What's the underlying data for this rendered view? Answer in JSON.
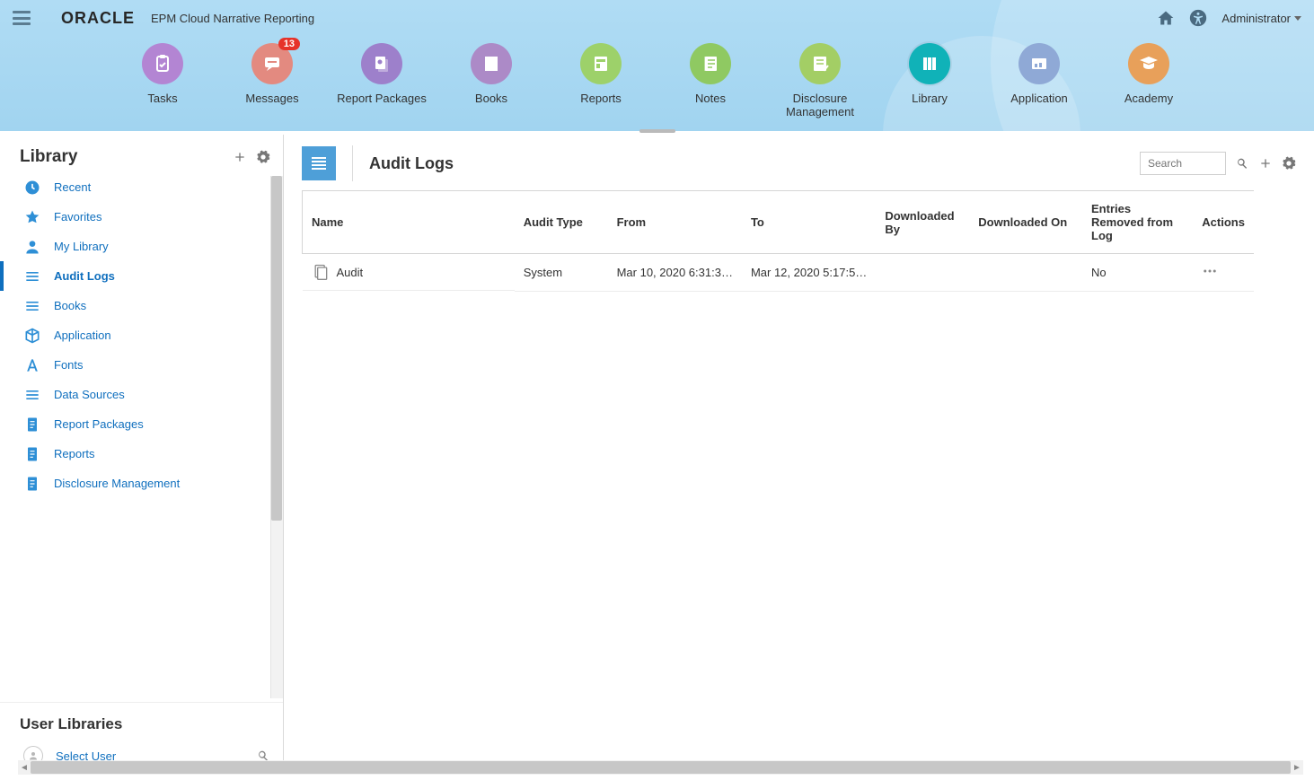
{
  "header": {
    "brand": "ORACLE",
    "product": "EPM Cloud Narrative Reporting",
    "user": "Administrator"
  },
  "nav": [
    {
      "label": "Tasks",
      "color": "#B385D3",
      "icon": "clipboard",
      "badge": null
    },
    {
      "label": "Messages",
      "color": "#E38A80",
      "icon": "chat",
      "badge": "13"
    },
    {
      "label": "Report Packages",
      "color": "#9D80CB",
      "icon": "report-pkg",
      "badge": null
    },
    {
      "label": "Books",
      "color": "#AC8AC7",
      "icon": "book",
      "badge": null
    },
    {
      "label": "Reports",
      "color": "#9DD16A",
      "icon": "report",
      "badge": null
    },
    {
      "label": "Notes",
      "color": "#8FC962",
      "icon": "notes",
      "badge": null
    },
    {
      "label": "Disclosure Management",
      "color": "#A3CE65",
      "icon": "disclosure",
      "badge": null
    },
    {
      "label": "Library",
      "color": "#10B2B8",
      "icon": "library",
      "badge": null,
      "active": true
    },
    {
      "label": "Application",
      "color": "#8FA9D6",
      "icon": "app",
      "badge": null
    },
    {
      "label": "Academy",
      "color": "#E8A05A",
      "icon": "academy",
      "badge": null
    }
  ],
  "sidebar": {
    "title": "Library",
    "items": [
      {
        "label": "Recent",
        "icon": "clock"
      },
      {
        "label": "Favorites",
        "icon": "star"
      },
      {
        "label": "My Library",
        "icon": "person"
      },
      {
        "label": "Audit Logs",
        "icon": "lines",
        "selected": true
      },
      {
        "label": "Books",
        "icon": "lines"
      },
      {
        "label": "Application",
        "icon": "cube"
      },
      {
        "label": "Fonts",
        "icon": "font"
      },
      {
        "label": "Data Sources",
        "icon": "lines"
      },
      {
        "label": "Report Packages",
        "icon": "doc"
      },
      {
        "label": "Reports",
        "icon": "doc"
      },
      {
        "label": "Disclosure Management",
        "icon": "doc"
      }
    ]
  },
  "userLibraries": {
    "title": "User Libraries",
    "selectUser": "Select User"
  },
  "main": {
    "title": "Audit Logs",
    "search_placeholder": "Search"
  },
  "table": {
    "columns": [
      "Name",
      "Audit Type",
      "From",
      "To",
      "Downloaded By",
      "Downloaded On",
      "Entries Removed from Log",
      "Actions"
    ],
    "rows": [
      {
        "name": "Audit",
        "audit_type": "System",
        "from": "Mar 10, 2020 6:31:3…",
        "to": "Mar 12, 2020 5:17:5…",
        "downloaded_by": "",
        "downloaded_on": "",
        "entries_removed": "No"
      }
    ]
  }
}
